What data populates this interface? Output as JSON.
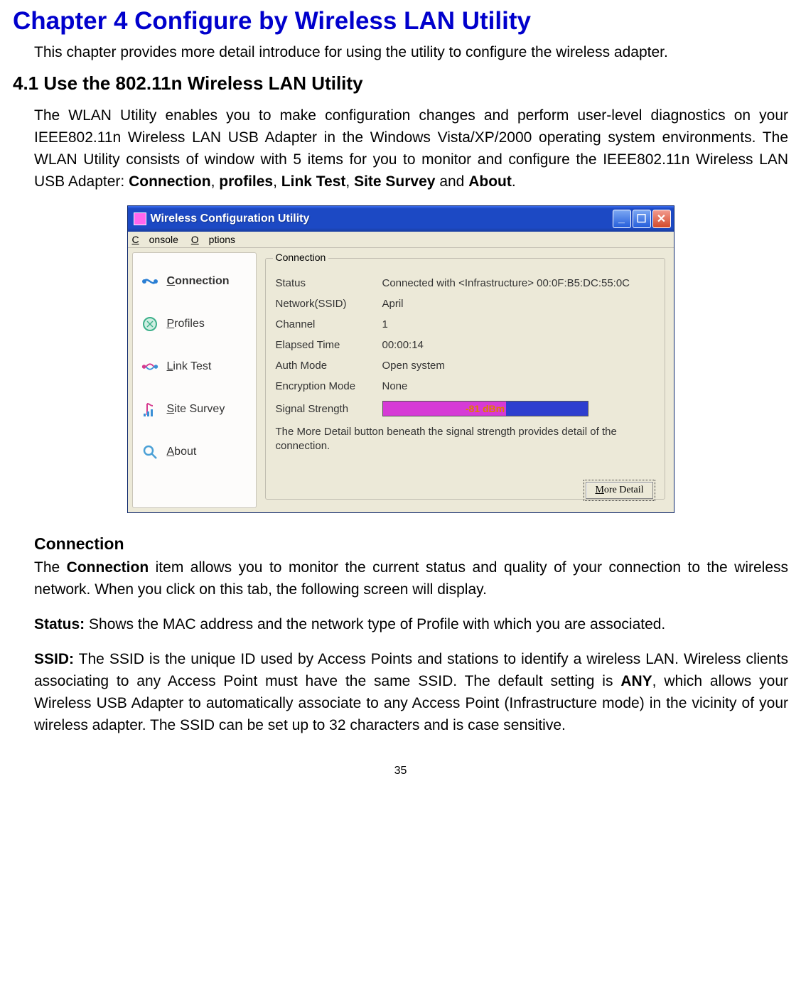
{
  "chapter": {
    "title": "Chapter 4    Configure by Wireless LAN Utility",
    "intro": "This chapter provides more detail introduce for using the utility to configure the wireless adapter."
  },
  "section": {
    "title": "4.1 Use the 802.11n Wireless LAN Utility",
    "para1_a": "The WLAN Utility enables you to make configuration changes and perform user-level diagnostics on your IEEE802.11n Wireless LAN USB Adapter in the Windows Vista/XP/2000 operating system environments. The WLAN Utility consists of window with 5 items for you to monitor and configure the IEEE802.11n Wireless LAN USB Adapter: ",
    "bold_connection": "Connection",
    "sep1": ", ",
    "bold_profiles": "profiles",
    "sep2": ", ",
    "bold_linktest": "Link Test",
    "sep3": ", ",
    "bold_sitesurvey": "Site Survey",
    "and": " and ",
    "bold_about": "About",
    "period": "."
  },
  "window": {
    "title": "Wireless Configuration Utility",
    "menu": {
      "console": "Console",
      "options": "Options",
      "console_u": "C",
      "options_u": "O"
    },
    "sidebar": [
      {
        "label_u": "C",
        "label_rest": "onnection"
      },
      {
        "label_u": "P",
        "label_rest": "rofiles"
      },
      {
        "label_u": "L",
        "label_rest": "ink Test"
      },
      {
        "label_u": "S",
        "label_rest": "ite Survey"
      },
      {
        "label_u": "A",
        "label_rest": "bout"
      }
    ],
    "group": {
      "title": "Connection",
      "status_label": "Status",
      "status_value": "Connected with <Infrastructure> 00:0F:B5:DC:55:0C",
      "ssid_label": "Network(SSID)",
      "ssid_value": "April",
      "channel_label": "Channel",
      "channel_value": "1",
      "elapsed_label": "Elapsed Time",
      "elapsed_value": "00:00:14",
      "auth_label": "Auth Mode",
      "auth_value": "Open system",
      "enc_label": "Encryption Mode",
      "enc_value": "None",
      "signal_label": "Signal Strength",
      "signal_value": "-81 dBm",
      "help": "The More Detail button beneath the signal strength provides detail of the connection.",
      "more_detail_u": "M",
      "more_detail_rest": "ore Detail"
    }
  },
  "desc": {
    "sub1": "Connection",
    "p1_a": "The ",
    "p1_b": "Connection",
    "p1_c": " item allows you to monitor the current status and quality of your connection to the wireless network. When you click on this tab, the following screen will display.",
    "p2_a": "Status:",
    "p2_b": " Shows the MAC address and the network type of Profile with which you are associated.",
    "p3_a": "SSID:",
    "p3_b": " The SSID is the unique ID used by Access Points and stations to identify a wireless LAN. Wireless clients associating to any Access Point must have the same SSID. The default setting is ",
    "p3_c": "ANY",
    "p3_d": ", which allows your Wireless USB Adapter to automatically associate to any Access Point (Infrastructure mode) in the vicinity of your wireless adapter. The SSID can be set up to 32 characters and is case sensitive."
  },
  "page_number": "35"
}
